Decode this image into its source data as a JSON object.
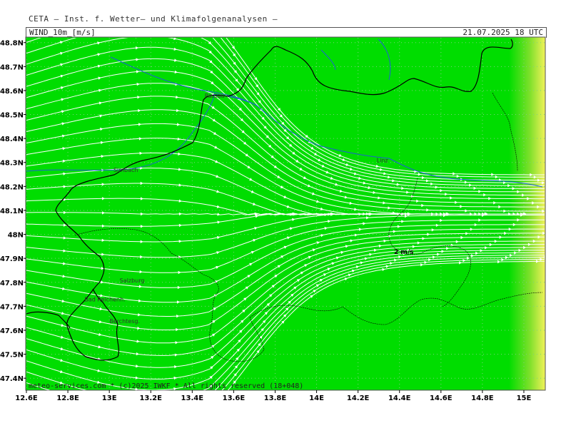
{
  "header": {
    "title": "CETA — Inst. f. Wetter— und Klimafolgenanalysen —"
  },
  "panel": {
    "variable": "WIND_10m_[m/s]",
    "valid_time": "21.07.2025 18 UTC"
  },
  "footer": {
    "credit": "meteo-services.com * (c)2025 IWKF * All rights reserved (18+048)"
  },
  "legend": {
    "reference_arrow": "2 m/s"
  },
  "axes": {
    "lat_ticks": [
      "48.8N",
      "48.7N",
      "48.6N",
      "48.5N",
      "48.4N",
      "48.3N",
      "48.2N",
      "48.1N",
      "48N",
      "47.9N",
      "47.8N",
      "47.7N",
      "47.6N",
      "47.5N",
      "47.4N"
    ],
    "lon_ticks": [
      "12.6E",
      "12.8E",
      "13E",
      "13.2E",
      "13.4E",
      "13.6E",
      "13.8E",
      "14E",
      "14.2E",
      "14.4E",
      "14.6E",
      "14.8E",
      "15E"
    ]
  },
  "cities": [
    {
      "name": "Passau",
      "lon": 13.46,
      "lat": 48.57
    },
    {
      "name": "Linz",
      "lon": 14.29,
      "lat": 48.3
    },
    {
      "name": "Simbach",
      "lon": 13.02,
      "lat": 48.26
    },
    {
      "name": "Salzburg",
      "lon": 13.05,
      "lat": 47.8
    },
    {
      "name": "Bad Reichenh.",
      "lon": 12.88,
      "lat": 47.72
    },
    {
      "name": "Berchtesg.",
      "lon": 13.0,
      "lat": 47.63
    }
  ],
  "colors": {
    "field": "#00dd00",
    "field_high": "#f2f25a",
    "streamline": "#ffffff",
    "border": "#000000",
    "river": "#1f5fd6",
    "grid": "#7fd07f"
  }
}
